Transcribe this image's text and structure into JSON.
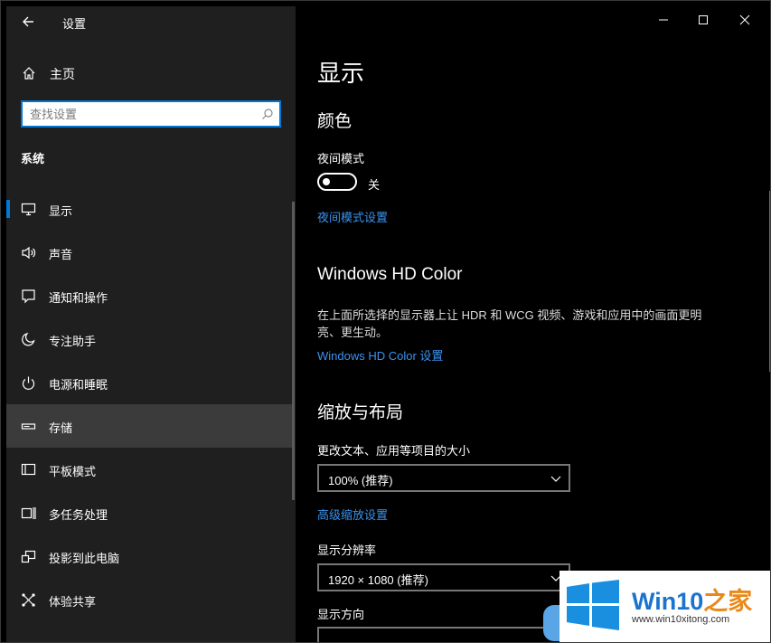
{
  "app": {
    "title": "设置"
  },
  "sidebar": {
    "home_label": "主页",
    "search": {
      "placeholder": "查找设置",
      "value": ""
    },
    "section_title": "系统",
    "items": [
      {
        "label": "显示",
        "icon": "monitor-icon",
        "selected": true
      },
      {
        "label": "声音",
        "icon": "speaker-icon"
      },
      {
        "label": "通知和操作",
        "icon": "notification-icon"
      },
      {
        "label": "专注助手",
        "icon": "moon-icon"
      },
      {
        "label": "电源和睡眠",
        "icon": "power-icon"
      },
      {
        "label": "存储",
        "icon": "storage-icon",
        "hover": true
      },
      {
        "label": "平板模式",
        "icon": "tablet-icon"
      },
      {
        "label": "多任务处理",
        "icon": "multitask-icon"
      },
      {
        "label": "投影到此电脑",
        "icon": "project-icon"
      },
      {
        "label": "体验共享",
        "icon": "share-icon"
      }
    ]
  },
  "main": {
    "page_title": "显示",
    "color": {
      "heading": "颜色",
      "night_light_label": "夜间模式",
      "night_light_state": "关",
      "night_light_link": "夜间模式设置"
    },
    "hdr": {
      "heading": "Windows HD Color",
      "description": "在上面所选择的显示器上让 HDR 和 WCG 视频、游戏和应用中的画面更明亮、更生动。",
      "link": "Windows HD Color 设置"
    },
    "scale": {
      "heading": "缩放与布局",
      "size_label": "更改文本、应用等项目的大小",
      "size_value": "100% (推荐)",
      "advanced_link": "高级缩放设置",
      "resolution_label": "显示分辨率",
      "resolution_value": "1920 × 1080 (推荐)",
      "orientation_label": "显示方向"
    }
  },
  "watermark": {
    "brand_a": "Win10",
    "brand_b": "之家",
    "url": "www.win10xitong.com"
  },
  "colors": {
    "accent": "#0078d7",
    "link": "#3a93f0",
    "sidebar_bg": "#1f1f1f",
    "main_bg": "#000000"
  }
}
